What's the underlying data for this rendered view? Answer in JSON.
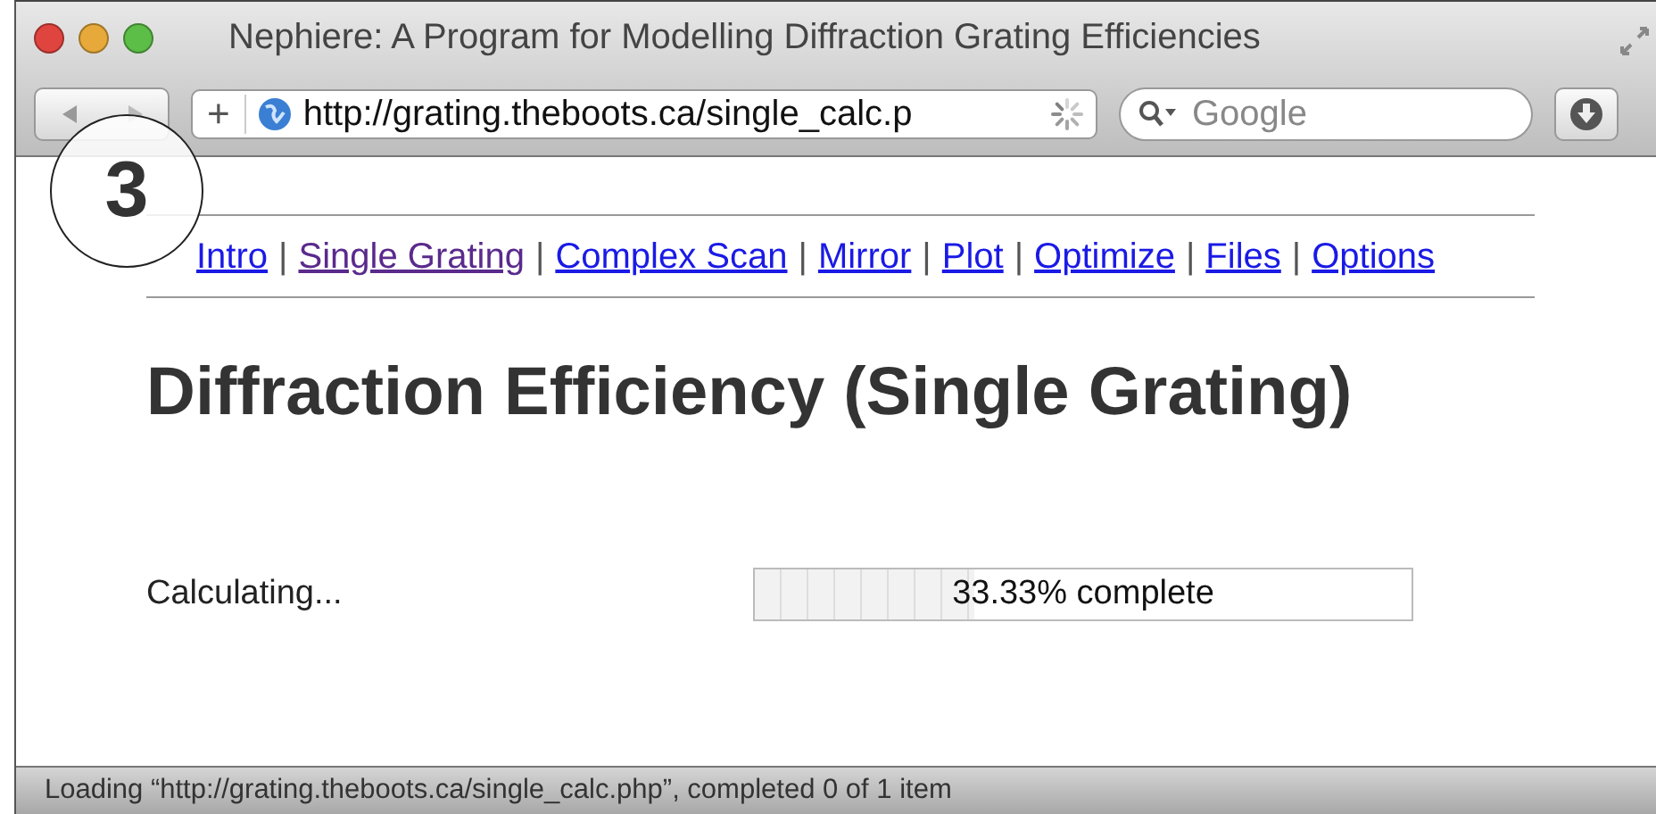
{
  "window": {
    "title": "Nephiere: A Program for Modelling Diffraction Grating Efficiencies"
  },
  "toolbar": {
    "add_button": "+",
    "address": "http://grating.theboots.ca/single_calc.p",
    "search": {
      "placeholder": "Google"
    }
  },
  "annotation": {
    "label": "3"
  },
  "nav": [
    {
      "label": "Intro",
      "visited": false
    },
    {
      "label": "Single Grating",
      "visited": true
    },
    {
      "label": "Complex Scan",
      "visited": false
    },
    {
      "label": "Mirror",
      "visited": false
    },
    {
      "label": "Plot",
      "visited": false
    },
    {
      "label": "Optimize",
      "visited": false
    },
    {
      "label": "Files",
      "visited": false
    },
    {
      "label": "Options",
      "visited": false
    }
  ],
  "separator": "|",
  "heading": "Diffraction Efficiency (Single Grating)",
  "status": {
    "label": "Calculating...",
    "progress": {
      "level": 0.3333,
      "reading": "33.33% complete"
    }
  },
  "status_bar": "Loading “http://grating.theboots.ca/single_calc.php”, completed 0 of 1 item"
}
